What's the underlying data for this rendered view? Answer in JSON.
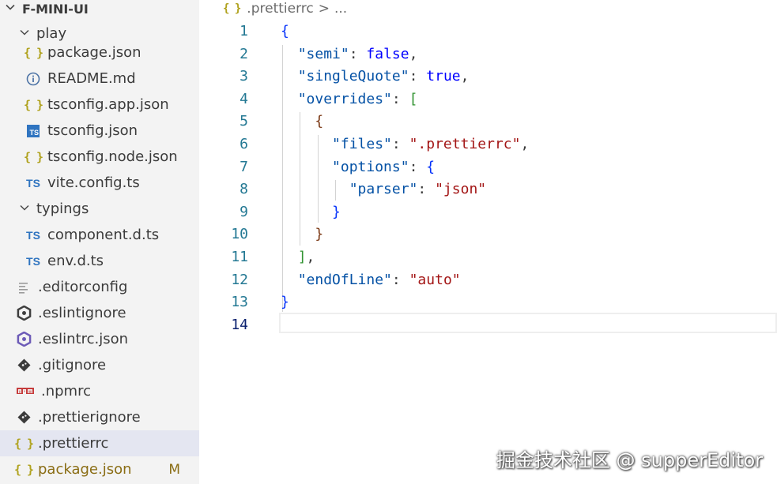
{
  "explorer": {
    "root": {
      "label": "F-MINI-UI",
      "chevron": "chevron-down-icon"
    },
    "items": [
      {
        "label": "play",
        "type": "folder",
        "icon": "chevron-down-icon"
      },
      {
        "label": "package.json",
        "type": "file",
        "icon": "json-braces-icon",
        "glyph": "{ }"
      },
      {
        "label": "README.md",
        "type": "file",
        "icon": "info-icon"
      },
      {
        "label": "tsconfig.app.json",
        "type": "file",
        "icon": "json-braces-icon",
        "glyph": "{ }"
      },
      {
        "label": "tsconfig.json",
        "type": "file",
        "icon": "typescript-config-icon",
        "glyph": "TS"
      },
      {
        "label": "tsconfig.node.json",
        "type": "file",
        "icon": "json-braces-icon",
        "glyph": "{ }"
      },
      {
        "label": "vite.config.ts",
        "type": "file",
        "icon": "typescript-icon",
        "glyph": "TS"
      },
      {
        "label": "typings",
        "type": "folder",
        "icon": "chevron-down-icon"
      },
      {
        "label": "component.d.ts",
        "type": "file",
        "icon": "typescript-icon",
        "glyph": "TS"
      },
      {
        "label": "env.d.ts",
        "type": "file",
        "icon": "typescript-icon",
        "glyph": "TS"
      },
      {
        "label": ".editorconfig",
        "type": "file",
        "icon": "lines-icon"
      },
      {
        "label": ".eslintignore",
        "type": "file",
        "icon": "eslint-icon"
      },
      {
        "label": ".eslintrc.json",
        "type": "file",
        "icon": "eslint-icon"
      },
      {
        "label": ".gitignore",
        "type": "file",
        "icon": "git-icon"
      },
      {
        "label": ".npmrc",
        "type": "file",
        "icon": "npm-icon",
        "glyph": "npm"
      },
      {
        "label": ".prettierignore",
        "type": "file",
        "icon": "git-icon"
      },
      {
        "label": ".prettierrc",
        "type": "file",
        "icon": "json-braces-icon",
        "glyph": "{ }",
        "selected": true
      },
      {
        "label": "package.json",
        "type": "file",
        "icon": "json-braces-icon",
        "glyph": "{ }",
        "badge": "M"
      }
    ]
  },
  "breadcrumb": {
    "icon": "json-braces-icon",
    "glyph": "{ }",
    "file": ".prettierrc",
    "separator": ">",
    "more": "..."
  },
  "editor": {
    "active_line": 14,
    "lines": [
      {
        "n": "1",
        "tokens": [
          [
            "{",
            "punc"
          ]
        ]
      },
      {
        "n": "2",
        "tokens": [
          [
            "  ",
            ""
          ],
          [
            "\"semi\"",
            "key"
          ],
          [
            ": ",
            "colon"
          ],
          [
            "false",
            "kw"
          ],
          [
            ",",
            "colon"
          ]
        ]
      },
      {
        "n": "3",
        "tokens": [
          [
            "  ",
            ""
          ],
          [
            "\"singleQuote\"",
            "key"
          ],
          [
            ": ",
            "colon"
          ],
          [
            "true",
            "kw"
          ],
          [
            ",",
            "colon"
          ]
        ]
      },
      {
        "n": "4",
        "tokens": [
          [
            "  ",
            ""
          ],
          [
            "\"overrides\"",
            "key"
          ],
          [
            ": ",
            "colon"
          ],
          [
            "[",
            "brace2"
          ]
        ]
      },
      {
        "n": "5",
        "tokens": [
          [
            "    ",
            ""
          ],
          [
            "{",
            "brace3"
          ]
        ]
      },
      {
        "n": "6",
        "tokens": [
          [
            "      ",
            ""
          ],
          [
            "\"files\"",
            "key"
          ],
          [
            ": ",
            "colon"
          ],
          [
            "\".prettierrc\"",
            "str"
          ],
          [
            ",",
            "colon"
          ]
        ]
      },
      {
        "n": "7",
        "tokens": [
          [
            "      ",
            ""
          ],
          [
            "\"options\"",
            "key"
          ],
          [
            ": ",
            "colon"
          ],
          [
            "{",
            "punc"
          ]
        ]
      },
      {
        "n": "8",
        "tokens": [
          [
            "        ",
            ""
          ],
          [
            "\"parser\"",
            "key"
          ],
          [
            ": ",
            "colon"
          ],
          [
            "\"json\"",
            "str"
          ]
        ]
      },
      {
        "n": "9",
        "tokens": [
          [
            "      ",
            ""
          ],
          [
            "}",
            "punc"
          ]
        ]
      },
      {
        "n": "10",
        "tokens": [
          [
            "    ",
            ""
          ],
          [
            "}",
            "brace3"
          ]
        ]
      },
      {
        "n": "11",
        "tokens": [
          [
            "  ",
            ""
          ],
          [
            "]",
            "brace2"
          ],
          [
            ",",
            "colon"
          ]
        ]
      },
      {
        "n": "12",
        "tokens": [
          [
            "  ",
            ""
          ],
          [
            "\"endOfLine\"",
            "key"
          ],
          [
            ": ",
            "colon"
          ],
          [
            "\"auto\"",
            "str"
          ]
        ]
      },
      {
        "n": "13",
        "tokens": [
          [
            "}",
            "punc"
          ]
        ]
      },
      {
        "n": "14",
        "tokens": []
      }
    ]
  },
  "watermark": "掘金技术社区 @ supperEditor",
  "colors": {
    "sidebar_bg": "#f3f3f3",
    "selected_row": "#e4e6f1",
    "json_key": "#0451a5",
    "json_string": "#a31515",
    "json_keyword": "#0000ff",
    "line_number": "#237893",
    "modified": "#8a6d14"
  }
}
